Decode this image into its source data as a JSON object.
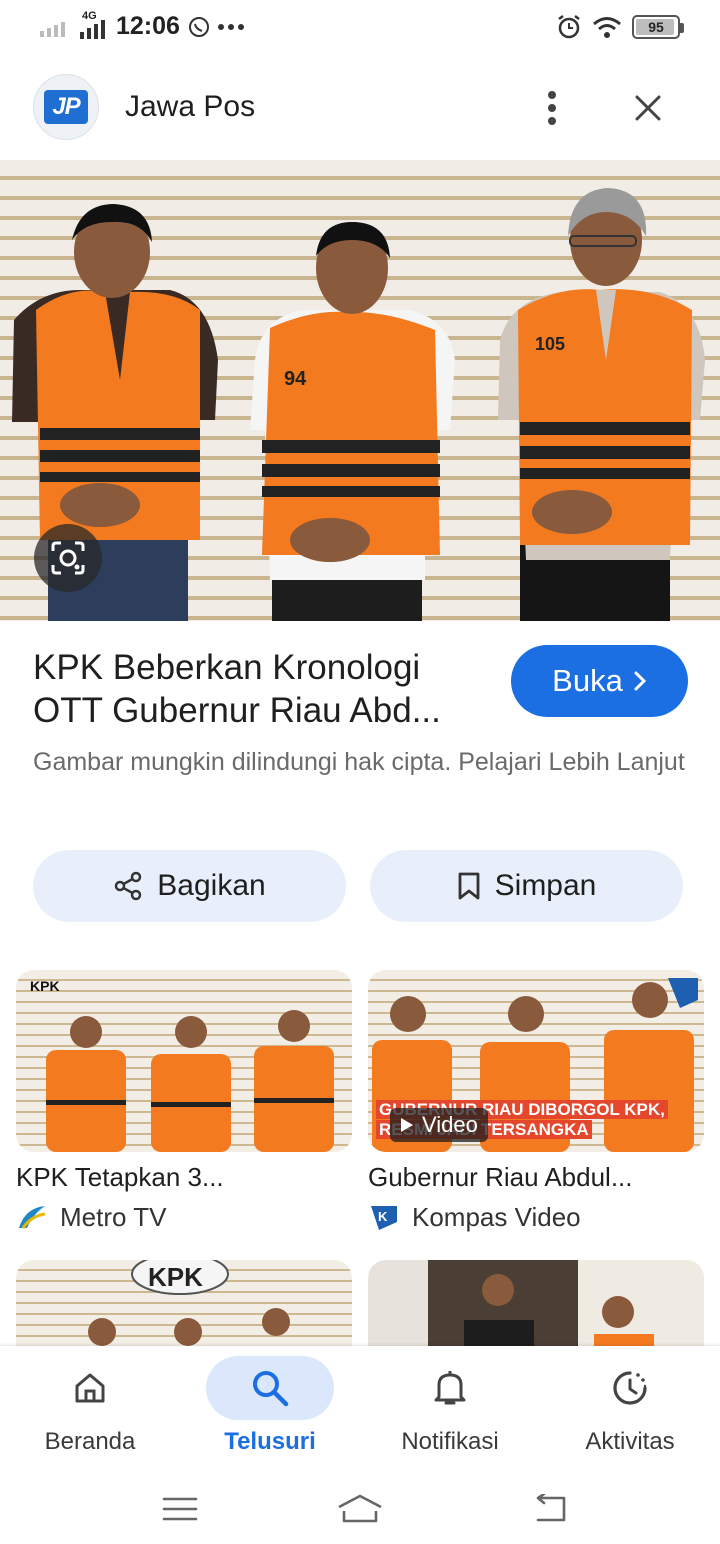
{
  "status_bar": {
    "network": "4G",
    "time": "12:06",
    "battery": 95
  },
  "header": {
    "logo_text": "JP",
    "site_name": "Jawa Pos"
  },
  "article": {
    "headline": "KPK Beberkan Kronologi OTT Gubernur Riau Abd...",
    "open_label": "Buka",
    "copyright_note": "Gambar mungkin dilindungi hak cipta. Pelajari Lebih Lanjut",
    "share_label": "Bagikan",
    "save_label": "Simpan"
  },
  "related": [
    {
      "title": "KPK Tetapkan 3...",
      "source": "Metro TV",
      "overlay": "KPK",
      "is_video": false
    },
    {
      "title": "Gubernur Riau Abdul...",
      "source": "Kompas Video",
      "video_label": "Video",
      "caption": [
        "GUBERNUR RIAU DIBORGOL KPK,",
        "RESMI JADI TERSANGKA"
      ],
      "is_video": true
    },
    {
      "overlay": "KPK"
    },
    {}
  ],
  "bottom_nav": [
    {
      "label": "Beranda",
      "icon": "home-icon",
      "active": false
    },
    {
      "label": "Telusuri",
      "icon": "search-icon",
      "active": true
    },
    {
      "label": "Notifikasi",
      "icon": "bell-icon",
      "active": false
    },
    {
      "label": "Aktivitas",
      "icon": "activity-icon",
      "active": false
    }
  ],
  "colors": {
    "accent": "#1b6fe3",
    "button_tint": "#e9effa",
    "vest_orange": "#f47a1f"
  }
}
